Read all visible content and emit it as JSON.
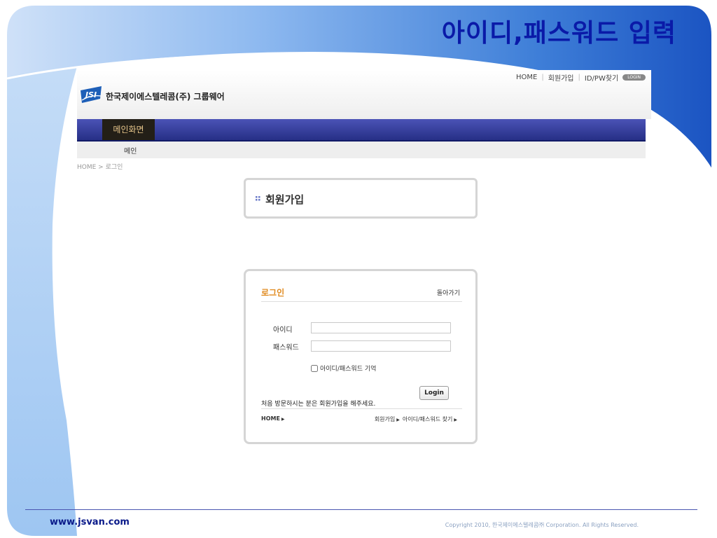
{
  "slide": {
    "title": "아이디,패스워드 입력"
  },
  "top_links": {
    "home": "HOME",
    "join": "회원가입",
    "idpw": "ID/PW찾기",
    "login_badge": "LOGIN"
  },
  "header": {
    "logo_text": "JSI",
    "company": "한국제이에스텔레콤(주) 그룹웨어"
  },
  "nav": {
    "main_tab": "메인화면",
    "sub_item": "메인"
  },
  "breadcrumb": "HOME > 로그인",
  "join_box": {
    "title": "회원가입"
  },
  "login_box": {
    "title": "로그인",
    "back": "돌아가기",
    "id_label": "아이디",
    "pw_label": "패스워드",
    "id_value": "",
    "pw_value": "",
    "remember_label": "아이디/패스워드 기억",
    "login_button": "Login",
    "first_visit": "처음 방문하시는 분은 회원가입을 해주세요.",
    "home_link": "HOME",
    "join_link": "회원가입",
    "find_link": "아이디/패스워드 찾기"
  },
  "footer": {
    "site": "www.jsvan.com",
    "copyright": "Copyright 2010, 한국제이에스텔레콤㈜ Corporation. All Rights Reserved."
  },
  "colors": {
    "slide_title": "#0a1aa8",
    "nav_bar": "#2f378f",
    "login_title": "#e08a1e",
    "deco_blue": "#3f7fd8"
  },
  "icons": {
    "logo": "jsi-logo-icon",
    "bullet": "double-dot-bullet-icon",
    "arrow": "triangle-right-icon"
  }
}
